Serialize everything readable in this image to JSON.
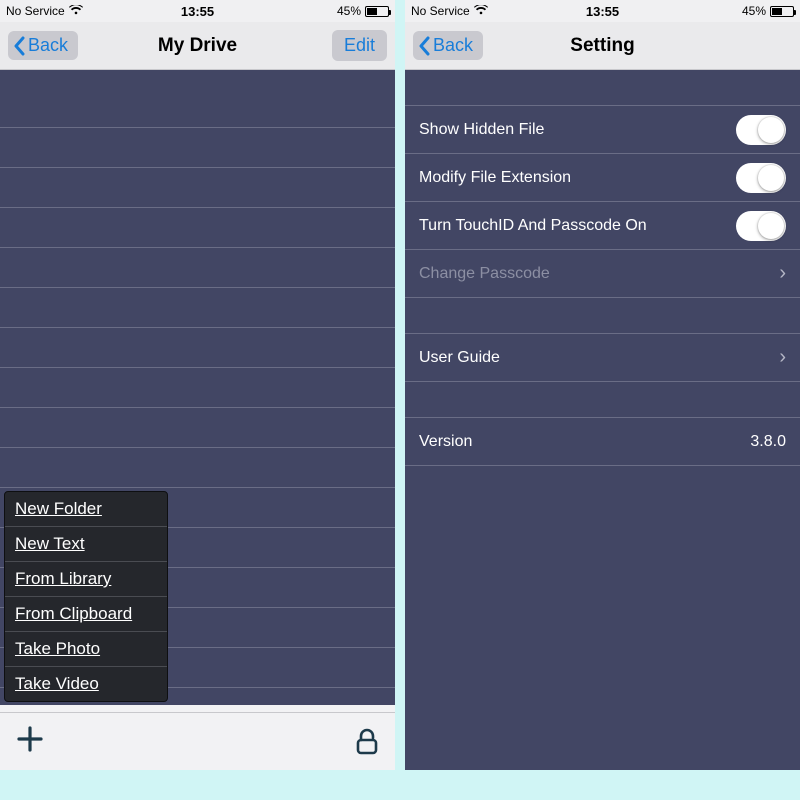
{
  "status": {
    "carrier": "No Service",
    "time": "13:55",
    "battery_pct": "45%"
  },
  "left": {
    "back": "Back",
    "title": "My Drive",
    "edit": "Edit",
    "menu": [
      "New Folder",
      "New Text",
      "From Library",
      "From Clipboard",
      "Take Photo",
      "Take Video"
    ]
  },
  "right": {
    "back": "Back",
    "title": "Setting",
    "rows": {
      "show_hidden": "Show Hidden File",
      "modify_ext": "Modify File Extension",
      "touchid": "Turn TouchID And Passcode On",
      "change_passcode": "Change Passcode",
      "user_guide": "User Guide",
      "version_label": "Version",
      "version_value": "3.8.0"
    }
  }
}
